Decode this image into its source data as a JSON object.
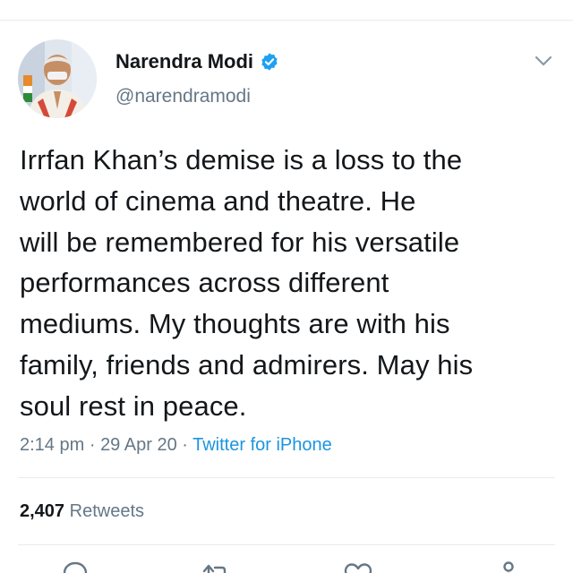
{
  "tweet": {
    "author": {
      "display_name": "Narendra Modi",
      "handle": "@narendramodi",
      "verified": true,
      "avatar_icon": "profile-photo"
    },
    "text": "Irrfan Khan’s demise is a loss to the\nworld of cinema and theatre. He\nwill be remembered for his versatile\nperformances across different\nmediums. My thoughts are with his\nfamily, friends and admirers. May his\nsoul rest in peace.",
    "time": "2:14 pm",
    "separator": "·",
    "date": "29 Apr 20",
    "source": "Twitter for iPhone",
    "retweets": {
      "count": "2,407",
      "label": "Retweets"
    },
    "actions": [
      "reply-icon",
      "retweet-icon",
      "like-icon",
      "share-icon"
    ]
  },
  "colors": {
    "text": "#14171a",
    "secondary": "#657786",
    "link": "#1b95e0",
    "verified": "#1da1f2",
    "divider": "#e6ecf0"
  }
}
